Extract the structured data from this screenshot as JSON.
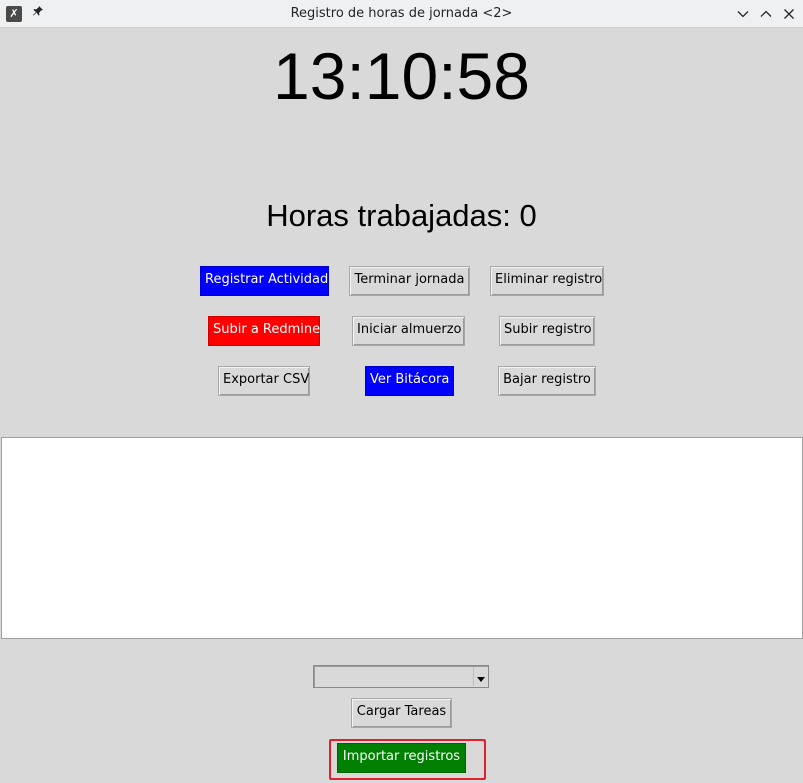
{
  "window": {
    "title": "Registro de horas de jornada <2>",
    "icons": {
      "app": "app-icon",
      "pin": "pin-icon",
      "minimize": "chevron-down-icon",
      "maximize": "chevron-up-icon",
      "close": "close-icon"
    }
  },
  "clock": {
    "time": "13:10:58"
  },
  "summary": {
    "hours_text": "Horas trabajadas: 0"
  },
  "actions": {
    "registrar_actividad": "Registrar Actividad",
    "terminar_jornada": "Terminar jornada",
    "eliminar_registro": "Eliminar registro",
    "subir_redmine": "Subir a Redmine",
    "iniciar_almuerzo": "Iniciar almuerzo",
    "subir_registro": "Subir registro",
    "exportar_csv": "Exportar CSV",
    "ver_bitacora": "Ver Bitácora",
    "bajar_registro": "Bajar registro"
  },
  "bottom": {
    "task_select_value": "",
    "cargar_tareas": "Cargar Tareas",
    "importar_registros": "Importar registros"
  },
  "colors": {
    "blue_button": "#0000ff",
    "red_button": "#ff0000",
    "green_button": "#008000",
    "highlight": "#e0202a"
  }
}
